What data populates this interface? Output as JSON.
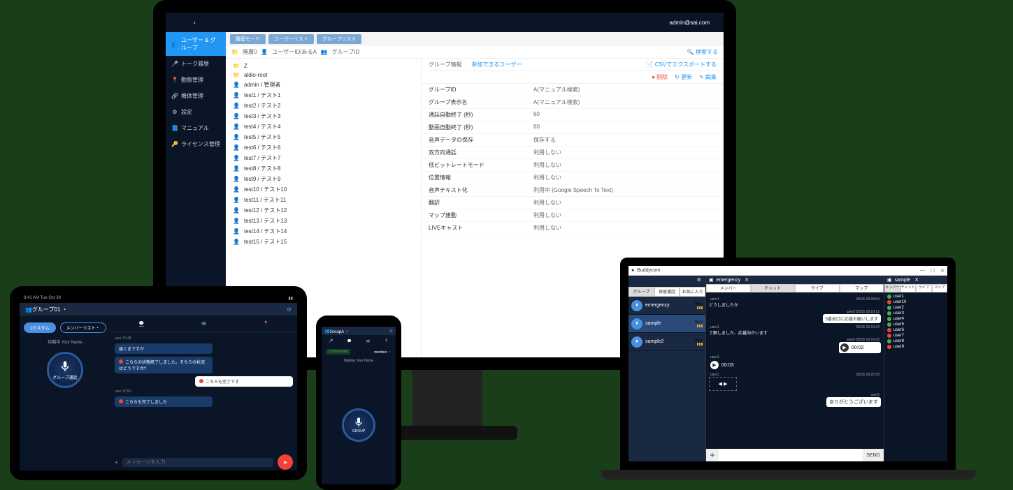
{
  "monitor": {
    "topbar": {
      "user": "admin@sai.com"
    },
    "sidebar": {
      "items": [
        {
          "label": "ユーザー & グループ",
          "active": true
        },
        {
          "label": "トーク履歴"
        },
        {
          "label": "動態管理"
        },
        {
          "label": "機体管理"
        },
        {
          "label": "設定"
        },
        {
          "label": "マニュアル"
        },
        {
          "label": "ライセンス管理"
        }
      ]
    },
    "tabs": [
      "履歴モード",
      "ユーザーリスト",
      "グループリスト"
    ],
    "breadcrumb": {
      "root": "階層0",
      "mid": "ユーザーID/あるA",
      "leaf": "グループID",
      "search": "検索する"
    },
    "csv_export": "CSVでエクスポートする",
    "list": [
      {
        "type": "folder",
        "label": "Z"
      },
      {
        "type": "folder",
        "label": "aldio-root"
      },
      {
        "type": "user",
        "label": "admin / 管理者"
      },
      {
        "type": "user",
        "label": "test1 / テスト1"
      },
      {
        "type": "user",
        "label": "test2 / テスト2"
      },
      {
        "type": "user",
        "label": "test3 / テスト3"
      },
      {
        "type": "user",
        "label": "test4 / テスト4"
      },
      {
        "type": "user",
        "label": "test5 / テスト5"
      },
      {
        "type": "user",
        "label": "test6 / テスト6"
      },
      {
        "type": "user",
        "label": "test7 / テスト7"
      },
      {
        "type": "user",
        "label": "test8 / テスト8"
      },
      {
        "type": "user",
        "label": "test9 / テスト9"
      },
      {
        "type": "user",
        "label": "test10 / テスト10"
      },
      {
        "type": "user",
        "label": "test11 / テスト11"
      },
      {
        "type": "user",
        "label": "test12 / テスト12"
      },
      {
        "type": "user",
        "label": "test13 / テスト13"
      },
      {
        "type": "user",
        "label": "test14 / テスト14"
      },
      {
        "type": "user",
        "label": "test15 / テスト15"
      }
    ],
    "detail_tabs": {
      "info": "グループ情報",
      "users": "参加できるユーザー"
    },
    "actions": {
      "delete": "削除",
      "update": "更新",
      "edit": "編集"
    },
    "details": [
      {
        "k": "グループID",
        "v": "A(マニュアル検索)"
      },
      {
        "k": "グループ表示名",
        "v": "A(マニュアル検索)"
      },
      {
        "k": "通話自動終了 (秒)",
        "v": "60"
      },
      {
        "k": "動画自動終了 (秒)",
        "v": "60"
      },
      {
        "k": "音声データの保存",
        "v": "保存する"
      },
      {
        "k": "双方向通話",
        "v": "利用しない"
      },
      {
        "k": "低ビットレートモード",
        "v": "利用しない"
      },
      {
        "k": "位置情報",
        "v": "利用しない"
      },
      {
        "k": "音声テキスト化",
        "v": "利用中 (Google Speech To Text)"
      },
      {
        "k": "翻訳",
        "v": "利用しない"
      },
      {
        "k": "マップ連動",
        "v": "利用しない"
      },
      {
        "k": "LIVEキャスト",
        "v": "利用しない"
      }
    ]
  },
  "tablet": {
    "status_left": "8:41 AM  Tue Oct 30",
    "header": "グループ01 ・",
    "pills": [
      "2カスタム",
      "メンバーリスト・"
    ],
    "waiting": "待機中  Your Name",
    "mic_label": "グループ通話",
    "chat_tabs": [
      "・",
      "・",
      "・"
    ],
    "bubbles": [
      {
        "type": "left-time",
        "text": "user  10:48"
      },
      {
        "type": "left",
        "text": "届くまですか"
      },
      {
        "type": "left-red",
        "text": "こちらの状態終了しました。そちらの状況はどうですか?"
      },
      {
        "type": "right",
        "text": "こちらも完了です"
      },
      {
        "type": "left-time2",
        "text": "user  10:50"
      },
      {
        "type": "left-red2",
        "text": "こちらも完了しました"
      }
    ],
    "input_placeholder": "メッセージを入力"
  },
  "phone": {
    "header": "GroupA ・",
    "tabs": [
      "・",
      "・",
      "・",
      "・"
    ],
    "connected": "2 connected",
    "member": "member ・",
    "waiting": "Waiting  Your Name",
    "mic_label": "GROUP"
  },
  "laptop": {
    "title": "Buddycom",
    "left_tabs": [
      "グループ",
      "保留通話",
      "お気に入り"
    ],
    "groups": [
      {
        "name": "emergency",
        "talk": "TALK",
        "active": false
      },
      {
        "name": "sample",
        "talk": "TALK",
        "active": true
      },
      {
        "name": "sample2",
        "talk": "TALK",
        "active": false
      }
    ],
    "mid_tab_title": "emergency",
    "mid_tabs": [
      "メンバー",
      "チャット",
      "ライブ",
      "マップ"
    ],
    "messages": [
      {
        "side": "left",
        "user": "user1",
        "time": "03/15 18:18:54",
        "text": "どうしましたか"
      },
      {
        "side": "right",
        "user": "user2",
        "time": "03/15 18:19:12",
        "text": "5番出口に応援お願いします"
      },
      {
        "side": "left",
        "user": "user1",
        "time": "03/15 18:19:24",
        "text": "了解しました、応援向かいます"
      },
      {
        "side": "right-audio",
        "user": "user2",
        "time": "03/15 18:19:33",
        "dur": "00:02"
      },
      {
        "side": "left-audio",
        "user": "user1",
        "time": "",
        "dur": "00:03"
      },
      {
        "side": "left-video",
        "user": "user1",
        "time": "03/15 18:20:39"
      },
      {
        "side": "right-last",
        "user": "user2",
        "time": "",
        "text": "ありがとうございます"
      }
    ],
    "send": "SEND",
    "right_tab_title": "sample",
    "right_tabs": [
      "メンバー",
      "チャット",
      "ライブ",
      "マップ"
    ],
    "users": [
      {
        "name": "user1",
        "status": "green"
      },
      {
        "name": "user10",
        "status": "red"
      },
      {
        "name": "user2",
        "status": "green"
      },
      {
        "name": "user3",
        "status": "green"
      },
      {
        "name": "user4",
        "status": "green"
      },
      {
        "name": "user5",
        "status": "green"
      },
      {
        "name": "user6",
        "status": "red"
      },
      {
        "name": "user7",
        "status": "red"
      },
      {
        "name": "user8",
        "status": "green"
      },
      {
        "name": "user9",
        "status": "red"
      }
    ]
  }
}
